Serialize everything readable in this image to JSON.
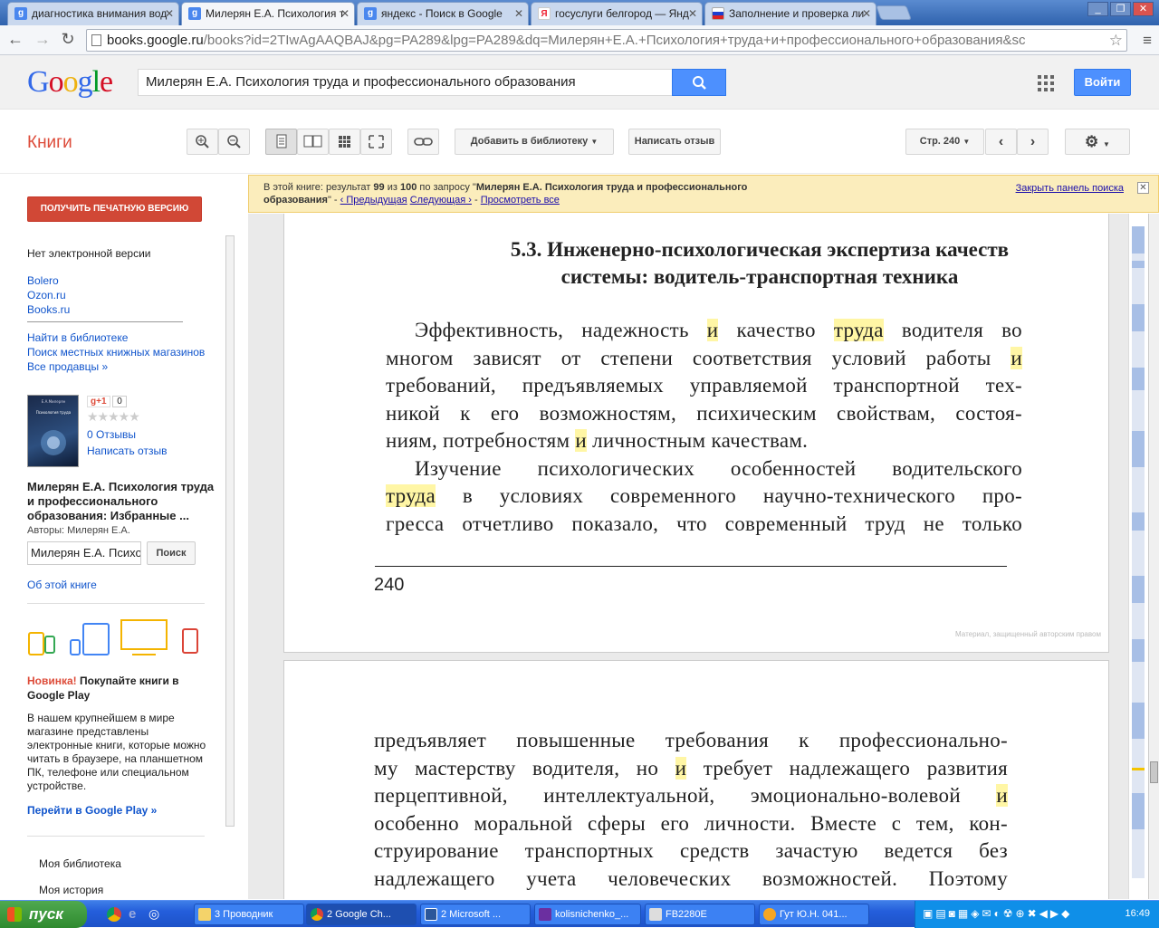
{
  "browser": {
    "tabs": [
      {
        "label": "диагностика внимания вод",
        "fav": "g",
        "color": "#4a87ee"
      },
      {
        "label": "Милерян Е.А. Психология т",
        "fav": "g",
        "color": "#4a87ee"
      },
      {
        "label": "яндекс - Поиск в Google",
        "fav": "g",
        "color": "#4a87ee"
      },
      {
        "label": "госуслуги белгород — Янд",
        "fav": "Я",
        "color": "#e23"
      },
      {
        "label": "Заполнение и проверка ли",
        "fav": "flag",
        "color": "#fff"
      }
    ],
    "url_host": "books.google.ru",
    "url_rest": "/books?id=2TIwAgAAQBAJ&pg=PA289&lpg=PA289&dq=Милерян+Е.А.+Психология+труда+и+профессионального+образования&sc"
  },
  "google": {
    "logo": "Google",
    "query": "Милерян Е.А. Психология труда и профессионального образования",
    "signin": "Войти"
  },
  "bookbar": {
    "title": "Книги",
    "add_library": "Добавить в библиотеку",
    "write_review": "Написать отзыв",
    "page": "Стр. 240"
  },
  "searchpanel": {
    "prefix": "В этой книге: результат ",
    "n": "99",
    "of": " из ",
    "total": "100",
    "mid": " по запросу \"",
    "query": "Милерян Е.А. Психология труда и профессионального образования",
    "suffix": "\"",
    "prev": "‹ Предыдущая",
    "next": "Следующая ›",
    "all": "Просмотреть все",
    "close": "Закрыть панель поиска"
  },
  "sidebar": {
    "print_btn": "ПОЛУЧИТЬ ПЕЧАТНУЮ ВЕРСИЮ",
    "no_ebook": "Нет электронной версии",
    "stores": [
      "Bolero",
      "Ozon.ru",
      "Books.ru"
    ],
    "library": "Найти в библиотеке",
    "local": "Поиск местных книжных магазинов",
    "all_sellers": "Все продавцы »",
    "gplus": "g+1",
    "gplus_count": "0",
    "reviews": "0 Отзывы",
    "write_review": "Написать отзыв",
    "book_title": "Милерян Е.А. Психология труда и профессионального образования: Избранные ...",
    "authors": "Авторы: Милерян Е.А.",
    "search_value": "Милерян Е.А. Психология",
    "search_btn": "Поиск",
    "about": "Об этой книге",
    "promo_new": "Новинка!",
    "promo_title": " Покупайте книги в Google Play",
    "promo_text": "В нашем крупнейшем в мире магазине представлены электронные книги, которые можно читать в браузере, на планшетном ПК, телефоне или специальном устройстве.",
    "promo_link": "Перейти в Google Play »",
    "my_library": "Моя библиотека",
    "my_history": "Моя история"
  },
  "page1": {
    "heading1": "5.3. Инженерно-психологическая экспертиза качеств",
    "heading2": "системы: водитель-транспортная техника",
    "page_number": "240",
    "copyright": "Материал, защищенный авторским правом"
  },
  "taskbar": {
    "start": "пуск",
    "tasks": [
      "3 Проводник",
      "2 Google Ch...",
      "2 Microsoft ...",
      "kolisnichenko_...",
      "FB2280E",
      "Гут Ю.Н. 041..."
    ],
    "clock": "16:49"
  }
}
